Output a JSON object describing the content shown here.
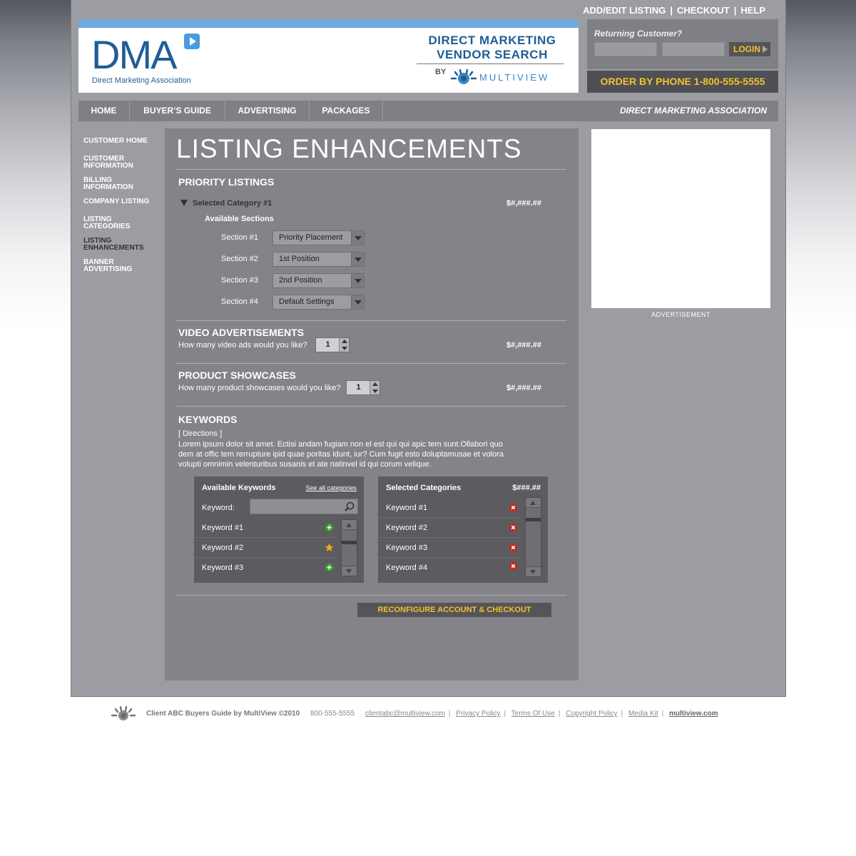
{
  "top_links": {
    "add_edit": "ADD/EDIT LISTING",
    "sep": "|",
    "checkout": "CHECKOUT",
    "help": "HELP"
  },
  "header": {
    "logo_text": "DMA",
    "logo_sub": "Direct Marketing Association",
    "vendor_line1": "DIRECT MARKETING",
    "vendor_line2": "VENDOR SEARCH",
    "by": "BY",
    "multiview": "MULTIVIEW"
  },
  "login": {
    "returning": "Returning Customer?",
    "button": "LOGIN"
  },
  "phone": "ORDER BY PHONE 1-800-555-5555",
  "nav": {
    "items": [
      "HOME",
      "BUYER’S GUIDE",
      "ADVERTISING",
      "PACKAGES"
    ],
    "org": "DIRECT MARKETING ASSOCIATION"
  },
  "sidebar": {
    "items": [
      "CUSTOMER HOME",
      "CUSTOMER INFORMATION",
      "BILLING INFORMATION",
      "COMPANY LISTING",
      "LISTING CATEGORIES",
      "LISTING ENHANCEMENTS",
      "BANNER ADVERTISING"
    ],
    "active": "LISTING ENHANCEMENTS"
  },
  "main": {
    "title": "LISTING ENHANCEMENTS",
    "priority": {
      "title": "PRIORITY LISTINGS",
      "category": "Selected Category #1",
      "price": "$#,###.##",
      "available": "Available Sections",
      "sections": [
        {
          "label": "Section #1",
          "value": "Priority Placement"
        },
        {
          "label": "Section #2",
          "value": "1st Position"
        },
        {
          "label": "Section #3",
          "value": "2nd Position"
        },
        {
          "label": "Section #4",
          "value": "Default Settings"
        }
      ]
    },
    "video": {
      "title": "VIDEO ADVERTISEMENTS",
      "question": "How many video ads would you like?",
      "quantity": "1",
      "price": "$#,###.##"
    },
    "showcase": {
      "title": "PRODUCT SHOWCASES",
      "question": "How many product showcases would you like?",
      "quantity": "1",
      "price": "$#,###.##"
    },
    "keywords": {
      "title": "KEYWORDS",
      "directions": "[ Directions ]",
      "body": "Lorem ipsum dolor sit amet. Ectisi andam fugiam non el est qui qui apic tem sunt.Ollabori quo dem at offic tem rerrupture ipid quae poritas idunt, iur? Cum fugit esto doluptamusae et volora volupti omnimin velenturibus susanis et ate natinvel id qui corum velique.",
      "available": {
        "title": "Available Keywords",
        "see_all": "See all categories",
        "input_label": "Keyword:",
        "input_value": "",
        "items": [
          {
            "label": "Keyword #1",
            "icon": "add-icon"
          },
          {
            "label": "Keyword #2",
            "icon": "star-icon"
          },
          {
            "label": "Keyword #3",
            "icon": "add-icon"
          }
        ]
      },
      "selected": {
        "title": "Selected Categories",
        "total": "$###.##",
        "items": [
          {
            "label": "Keyword #1",
            "icon": "remove-icon"
          },
          {
            "label": "Keyword #2",
            "icon": "remove-icon"
          },
          {
            "label": "Keyword #3",
            "icon": "remove-icon"
          },
          {
            "label": "Keyword #4",
            "icon": "remove-icon"
          }
        ]
      }
    },
    "checkout_button": "RECONFIGURE ACCOUNT & CHECKOUT"
  },
  "ad": {
    "label": "ADVERTISEMENT"
  },
  "footer": {
    "brand": "Client ABC Buyers Guide by MultiView ©2010",
    "phone": "800-555-5555",
    "email": "clientabc@multiview.com",
    "privacy": "Privacy Policy",
    "terms": "Terms Of Use",
    "copyright": "Copyright Policy",
    "media": "Media Kit",
    "site": "multiview.com",
    "bar": "|"
  },
  "colors": {
    "accent_gold": "#f3c12c",
    "brand_blue": "#1f5d96",
    "stripe_blue": "#6fa9db",
    "add_green": "#3aa02b",
    "remove_red": "#c8281e",
    "star_orange": "#f2a81d"
  }
}
